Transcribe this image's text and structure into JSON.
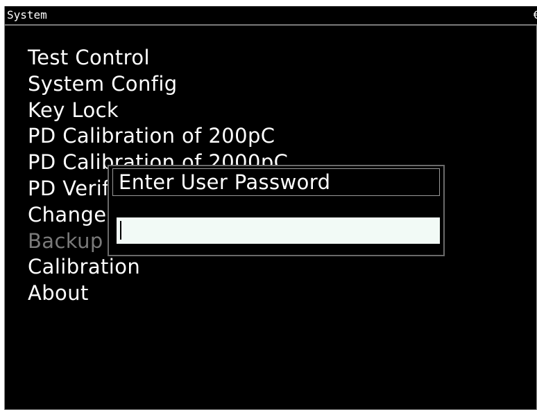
{
  "window": {
    "title": "System",
    "corner_glyph": "€"
  },
  "menu": {
    "items": [
      {
        "label": "Test Control",
        "enabled": true
      },
      {
        "label": "System Config",
        "enabled": true
      },
      {
        "label": "Key Lock",
        "enabled": true
      },
      {
        "label": "PD Calibration of 200pC",
        "enabled": true
      },
      {
        "label": "PD Calibration of 2000pC",
        "enabled": true
      },
      {
        "label": "PD Verification",
        "enabled": true
      },
      {
        "label": "Change Password",
        "enabled": true
      },
      {
        "label": "Backup",
        "enabled": false
      },
      {
        "label": "Calibration",
        "enabled": true
      },
      {
        "label": "About",
        "enabled": true
      }
    ]
  },
  "dialog": {
    "title": "Enter User Password",
    "input_value": ""
  },
  "colors": {
    "background": "#000000",
    "text": "#ffffff",
    "disabled_text": "#7a7a7a",
    "input_background": "#f2faf6",
    "border": "#8a8a8a"
  }
}
